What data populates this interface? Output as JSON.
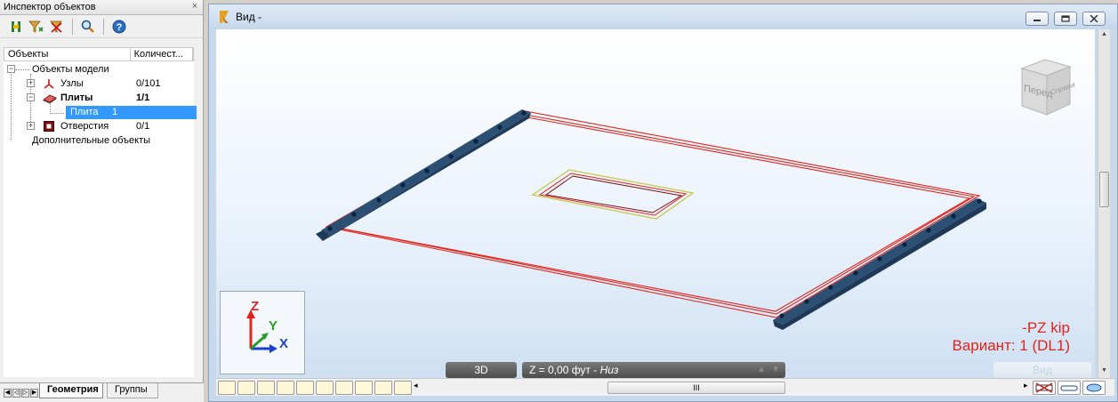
{
  "inspector": {
    "title": "Инспектор объектов",
    "close_glyph": "×",
    "toolbar_icons": [
      "tree-columns-icon",
      "filter-icon",
      "filter-clear-icon",
      "search-icon",
      "help-icon"
    ],
    "columns": [
      "Объекты",
      "Количест..."
    ],
    "tree": {
      "root_label": "Объекты модели",
      "nodes_label": "Узлы",
      "nodes_count": "0/101",
      "plates_label": "Плиты",
      "plates_count": "1/1",
      "plate_item_label": "Плита",
      "plate_item_count": "1",
      "openings_label": "Отверстия",
      "openings_count": "0/1",
      "extra_label": "Дополнительные объекты"
    },
    "tabs": [
      "Геометрия",
      "Группы"
    ]
  },
  "view": {
    "title": "Вид -",
    "cube_labels": [
      "Перед",
      "Справа"
    ],
    "mode_label": "3D",
    "z_label": "Z = 0,00 фут - ",
    "z_side": "Низ",
    "right_pill": "Вид",
    "units_line": "-PZ   kip",
    "variant_line": "Вариант: 1 (DL1)",
    "axes": {
      "z": "Z",
      "y": "Y",
      "x": "X"
    },
    "scroll_grip": "III",
    "colors": {
      "plate_edge": "#e0241c",
      "support": "#2c4f74",
      "opening_outer": "#c8c84a",
      "viewport_top": "#ffffff",
      "viewport_bottom": "#cfe0f3"
    }
  }
}
